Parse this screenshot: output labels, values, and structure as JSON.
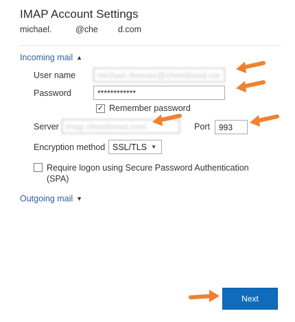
{
  "header": {
    "title": "IMAP Account Settings",
    "email_parts": [
      "michael.",
      "@che",
      "d.com"
    ]
  },
  "incoming": {
    "toggle_label": "Incoming mail",
    "username_label": "User name",
    "username_value": "michael.thomas@chembiosd.com",
    "password_label": "Password",
    "password_value": "************",
    "remember_label": "Remember password",
    "remember_checked": true,
    "server_label": "Server",
    "server_value": "imap.chembiosd.com",
    "port_label": "Port",
    "port_value": "993",
    "encryption_label": "Encryption method",
    "encryption_value": "SSL/TLS",
    "spa_label": "Require logon using Secure Password Authentication (SPA)",
    "spa_checked": false
  },
  "outgoing": {
    "toggle_label": "Outgoing mail"
  },
  "footer": {
    "next_label": "Next"
  },
  "colors": {
    "accent": "#0f6cbd",
    "link": "#2e5f9e",
    "annotation_arrow": "#f08030"
  }
}
